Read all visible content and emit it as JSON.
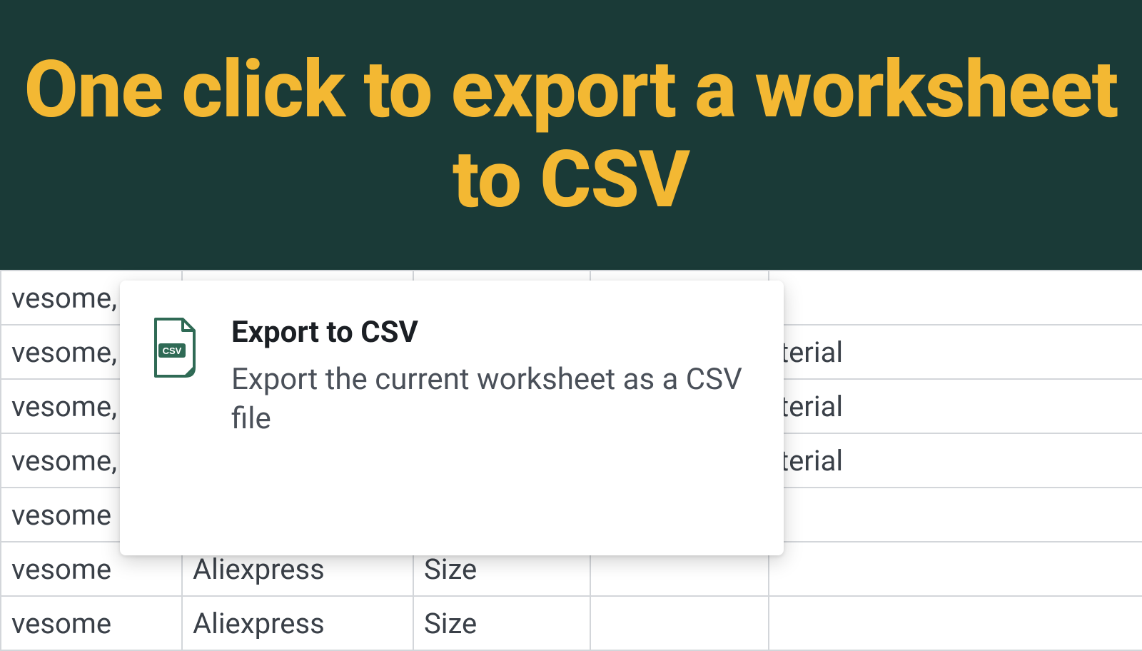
{
  "banner": {
    "headline": "One click to export a worksheet to CSV"
  },
  "card": {
    "title": "Export to CSV",
    "description": "Export the current worksheet as a CSV file",
    "icon_label": "CSV"
  },
  "sheet": {
    "rows": [
      {
        "a": "vesome, fr",
        "b": "",
        "c": "",
        "d": "",
        "e": ""
      },
      {
        "a": "vesome, fr",
        "b": "",
        "c": "",
        "d": "",
        "e": "terial"
      },
      {
        "a": "vesome, fr",
        "b": "",
        "c": "",
        "d": "",
        "e": "terial"
      },
      {
        "a": "vesome, fr",
        "b": "",
        "c": "",
        "d": "",
        "e": "terial"
      },
      {
        "a": "vesome",
        "b": "",
        "c": "",
        "d": "",
        "e": ""
      },
      {
        "a": "vesome",
        "b": "Aliexpress",
        "c": "Size",
        "d": "",
        "e": ""
      },
      {
        "a": "vesome",
        "b": "Aliexpress",
        "c": "Size",
        "d": "",
        "e": ""
      }
    ]
  }
}
